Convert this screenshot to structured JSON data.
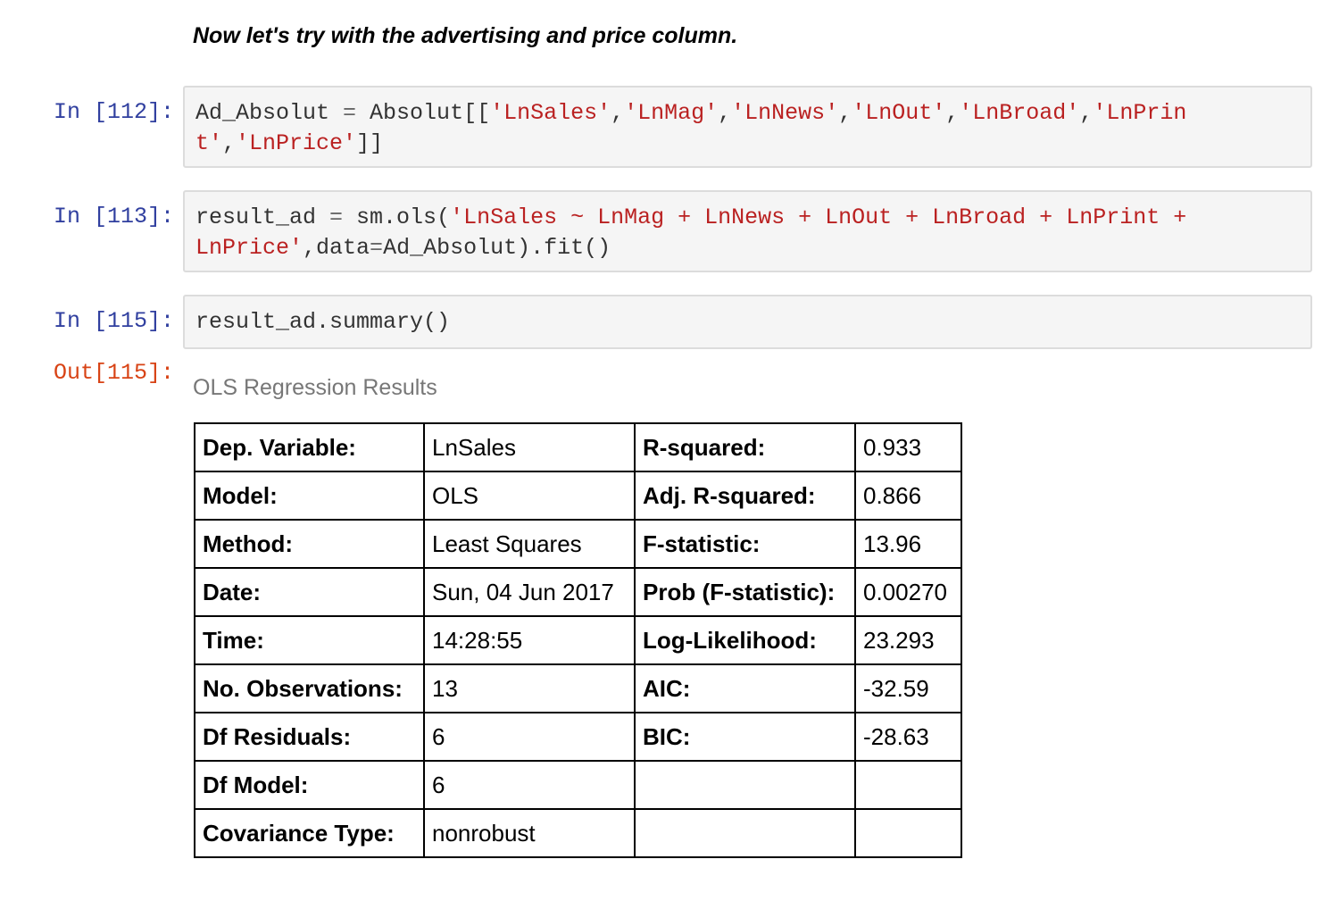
{
  "markdown": {
    "text": "Now let's try with the advertising and price column."
  },
  "cells": [
    {
      "prompt": "In [112]:",
      "lines": [
        [
          {
            "t": "Ad_Absolut ",
            "k": "plain"
          },
          {
            "t": "=",
            "k": "op"
          },
          {
            "t": " Absolut[[",
            "k": "plain"
          },
          {
            "t": "'LnSales'",
            "k": "str"
          },
          {
            "t": ",",
            "k": "plain"
          },
          {
            "t": "'LnMag'",
            "k": "str"
          },
          {
            "t": ",",
            "k": "plain"
          },
          {
            "t": "'LnNews'",
            "k": "str"
          },
          {
            "t": ",",
            "k": "plain"
          },
          {
            "t": "'LnOut'",
            "k": "str"
          },
          {
            "t": ",",
            "k": "plain"
          },
          {
            "t": "'LnBroad'",
            "k": "str"
          },
          {
            "t": ",",
            "k": "plain"
          },
          {
            "t": "'LnPrin",
            "k": "str"
          }
        ],
        [
          {
            "t": "t'",
            "k": "str"
          },
          {
            "t": ",",
            "k": "plain"
          },
          {
            "t": "'LnPrice'",
            "k": "str"
          },
          {
            "t": "]]",
            "k": "plain"
          }
        ]
      ]
    },
    {
      "prompt": "In [113]:",
      "lines": [
        [
          {
            "t": "result_ad ",
            "k": "plain"
          },
          {
            "t": "=",
            "k": "op"
          },
          {
            "t": " sm.ols(",
            "k": "plain"
          },
          {
            "t": "'LnSales ~ LnMag + LnNews + LnOut + LnBroad + LnPrint +",
            "k": "str"
          }
        ],
        [
          {
            "t": "LnPrice'",
            "k": "str"
          },
          {
            "t": ",data",
            "k": "plain"
          },
          {
            "t": "=",
            "k": "op"
          },
          {
            "t": "Ad_Absolut).fit()",
            "k": "plain"
          }
        ]
      ]
    },
    {
      "prompt": "In [115]:",
      "lines": [
        [
          {
            "t": "result_ad.summary()",
            "k": "plain"
          }
        ]
      ]
    }
  ],
  "output": {
    "prompt": "Out[115]:",
    "caption": "OLS Regression Results",
    "rows": [
      [
        "Dep. Variable:",
        "LnSales",
        "R-squared:",
        "0.933"
      ],
      [
        "Model:",
        "OLS",
        "Adj. R-squared:",
        "0.866"
      ],
      [
        "Method:",
        "Least Squares",
        "F-statistic:",
        "13.96"
      ],
      [
        "Date:",
        "Sun, 04 Jun 2017",
        "Prob (F-statistic):",
        "0.00270"
      ],
      [
        "Time:",
        "14:28:55",
        "Log-Likelihood:",
        "23.293"
      ],
      [
        "No. Observations:",
        "13",
        "AIC:",
        "-32.59"
      ],
      [
        "Df Residuals:",
        "6",
        "BIC:",
        "-28.63"
      ],
      [
        "Df Model:",
        "6",
        "",
        ""
      ],
      [
        "Covariance Type:",
        "nonrobust",
        "",
        ""
      ]
    ]
  }
}
